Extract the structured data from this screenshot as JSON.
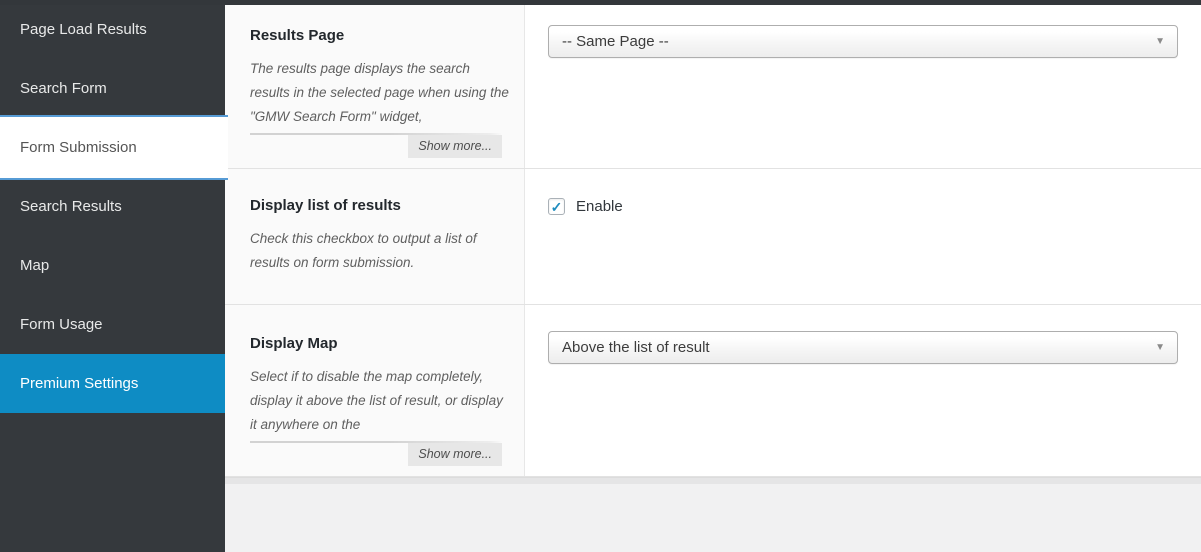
{
  "sidebar": {
    "items": [
      {
        "label": "Page Load Results",
        "state": "normal"
      },
      {
        "label": "Search Form",
        "state": "normal"
      },
      {
        "label": "Form Submission",
        "state": "active"
      },
      {
        "label": "Search Results",
        "state": "normal"
      },
      {
        "label": "Map",
        "state": "normal"
      },
      {
        "label": "Form Usage",
        "state": "normal"
      },
      {
        "label": "Premium Settings",
        "state": "highlighted"
      }
    ]
  },
  "settings_rows": [
    {
      "title": "Results Page",
      "description": "The results page displays the search results in the selected page when using the \"GMW Search Form\" widget,",
      "show_more_label": "Show more...",
      "control": {
        "type": "select",
        "selected_value": "-- Same Page --"
      }
    },
    {
      "title": "Display list of results",
      "description": "Check this checkbox to output a list of results on form submission.",
      "control": {
        "type": "checkbox",
        "checked": true,
        "label": "Enable"
      }
    },
    {
      "title": "Display Map",
      "description": "Select if to disable the map completely, display it above the list of result, or display it anywhere on the",
      "show_more_label": "Show more...",
      "control": {
        "type": "select",
        "selected_value": "Above the list of result"
      }
    }
  ],
  "icons": {
    "dropdown_arrow": "▼",
    "checkmark": "✓"
  },
  "colors": {
    "sidebar_bg": "#35393d",
    "premium_tab_bg": "#0e8cc4",
    "active_tab_border": "#569bd5",
    "checkmark": "#1e8cbe"
  }
}
